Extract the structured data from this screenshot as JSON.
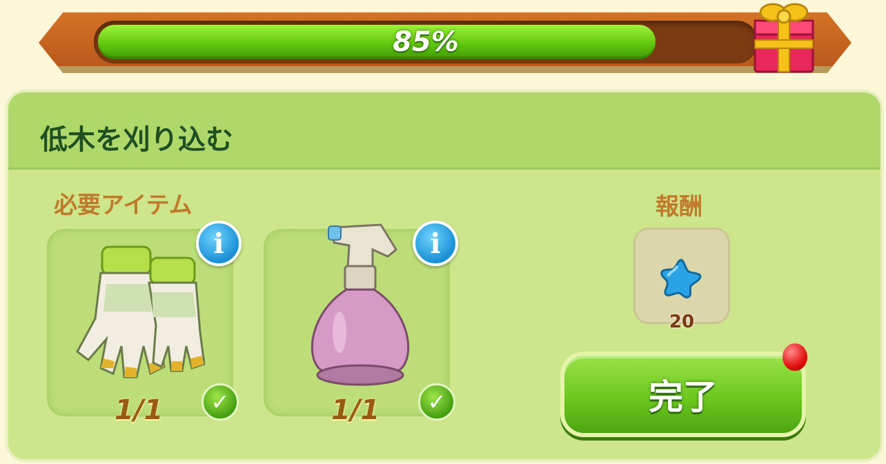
{
  "progress": {
    "value": 0.85,
    "label": "85%"
  },
  "task": {
    "title": "低木を刈り込む"
  },
  "required": {
    "label": "必要アイテム",
    "items": [
      {
        "icon": "gardening-gloves-icon",
        "count": "1/1",
        "complete": true
      },
      {
        "icon": "spray-bottle-icon",
        "count": "1/1",
        "complete": true
      }
    ]
  },
  "reward": {
    "label": "報酬",
    "icon": "blue-star-icon",
    "amount": "20"
  },
  "complete_button": {
    "label": "完了"
  },
  "colors": {
    "progress_green": "#62c80f",
    "banner_orange": "#c9651f",
    "panel_green": "#cde68b",
    "title_dark_green": "#1f4f22",
    "label_orange": "#c07a2c",
    "info_blue": "#1a8fd6",
    "notification_red": "#e2100e"
  }
}
